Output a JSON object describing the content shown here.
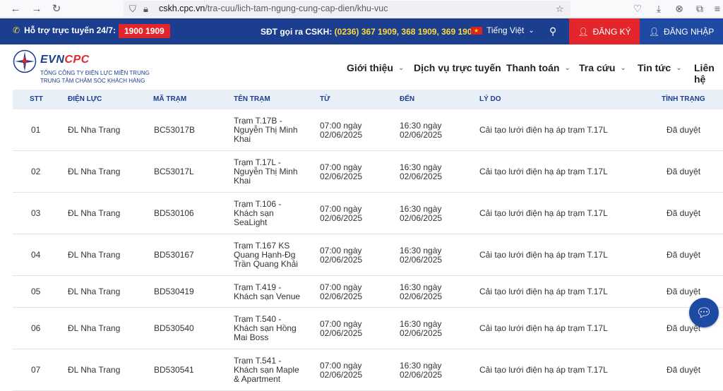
{
  "browser": {
    "url_host": "cskh.cpc.vn",
    "url_path": "/tra-cuu/lich-tam-ngung-cung-cap-dien/khu-vuc"
  },
  "topbar": {
    "support_label": "Hỗ trợ trực tuyến 24/7:",
    "hotline": "1900 1909",
    "cskh_label": "SĐT gọi ra CSKH: ",
    "cskh_numbers": "(0236) 367 1909, 368 1909, 369 1909",
    "language": "Tiếng Việt",
    "register": "ĐĂNG KÝ",
    "login": "ĐĂNG NHẬP"
  },
  "header": {
    "logo_evn": "EVN",
    "logo_cpc": "CPC",
    "logo_sub1": "TỔNG CÔNG TY ĐIỆN LỰC MIỀN TRUNG",
    "logo_sub2": "TRUNG TÂM CHĂM SÓC KHÁCH HÀNG",
    "menu": [
      "Giới thiệu",
      "Dịch vụ trực tuyến",
      "Thanh toán",
      "Tra cứu",
      "Tin tức",
      "Liên hệ"
    ]
  },
  "table": {
    "headers": [
      "STT",
      "ĐIỆN LỰC",
      "MÃ TRẠM",
      "TÊN TRẠM",
      "TỪ",
      "ĐẾN",
      "LÝ DO",
      "TÌNH TRẠNG"
    ],
    "rows": [
      {
        "stt": "01",
        "dienluc": "ĐL Nha Trang",
        "matram": "BC53017B",
        "tentram": [
          "Trạm T.17B -",
          "Nguyễn Thị Minh",
          "Khai"
        ],
        "tu": [
          "07:00 ngày",
          "02/06/2025"
        ],
        "den": [
          "16:30 ngày",
          "02/06/2025"
        ],
        "lydo": "Cải tạo lưới điện hạ áp trạm T.17L",
        "tinhtrang": "Đã duyệt"
      },
      {
        "stt": "02",
        "dienluc": "ĐL Nha Trang",
        "matram": "BC53017L",
        "tentram": [
          "Trạm T.17L -",
          "Nguyễn Thị Minh",
          "Khai"
        ],
        "tu": [
          "07:00 ngày",
          "02/06/2025"
        ],
        "den": [
          "16:30 ngày",
          "02/06/2025"
        ],
        "lydo": "Cải tạo lưới điện hạ áp trạm T.17L",
        "tinhtrang": "Đã duyệt"
      },
      {
        "stt": "03",
        "dienluc": "ĐL Nha Trang",
        "matram": "BD530106",
        "tentram": [
          "Trạm T.106 -",
          "Khách sạn",
          "SeaLight"
        ],
        "tu": [
          "07:00 ngày",
          "02/06/2025"
        ],
        "den": [
          "16:30 ngày",
          "02/06/2025"
        ],
        "lydo": "Cải tạo lưới điện hạ áp trạm T.17L",
        "tinhtrang": "Đã duyệt"
      },
      {
        "stt": "04",
        "dienluc": "ĐL Nha Trang",
        "matram": "BD530167",
        "tentram": [
          "Trạm T.167 KS",
          "Quang Hạnh-Đg",
          "Trần Quang Khải"
        ],
        "tu": [
          "07:00 ngày",
          "02/06/2025"
        ],
        "den": [
          "16:30 ngày",
          "02/06/2025"
        ],
        "lydo": "Cải tạo lưới điện hạ áp trạm T.17L",
        "tinhtrang": "Đã duyệt"
      },
      {
        "stt": "05",
        "dienluc": "ĐL Nha Trang",
        "matram": "BD530419",
        "tentram": [
          "Trạm T.419 -",
          "Khách sạn Venue"
        ],
        "tu": [
          "07:00 ngày",
          "02/06/2025"
        ],
        "den": [
          "16:30 ngày",
          "02/06/2025"
        ],
        "lydo": "Cải tạo lưới điện hạ áp trạm T.17L",
        "tinhtrang": "Đã duyệt"
      },
      {
        "stt": "06",
        "dienluc": "ĐL Nha Trang",
        "matram": "BD530540",
        "tentram": [
          "Trạm T.540 -",
          "Khách sạn Hồng",
          "Mai Boss"
        ],
        "tu": [
          "07:00 ngày",
          "02/06/2025"
        ],
        "den": [
          "16:30 ngày",
          "02/06/2025"
        ],
        "lydo": "Cải tạo lưới điện hạ áp trạm T.17L",
        "tinhtrang": "Đã duyệt"
      },
      {
        "stt": "07",
        "dienluc": "ĐL Nha Trang",
        "matram": "BD530541",
        "tentram": [
          "Trạm T.541 -",
          "Khách sạn Maple",
          "& Apartment"
        ],
        "tu": [
          "07:00 ngày",
          "02/06/2025"
        ],
        "den": [
          "16:30 ngày",
          "02/06/2025"
        ],
        "lydo": "Cải tạo lưới điện hạ áp trạm T.17L",
        "tinhtrang": "Đã duyệt"
      }
    ]
  }
}
